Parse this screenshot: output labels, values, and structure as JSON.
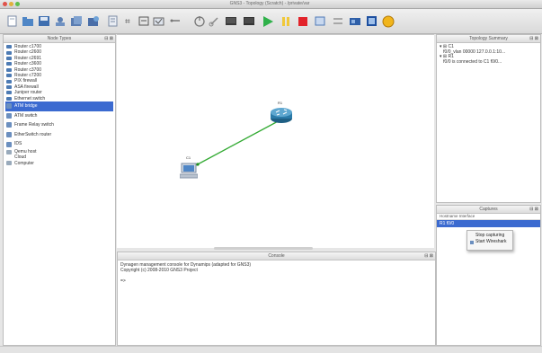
{
  "window": {
    "title": "GNS3 - Topology (Scratch) - /private/var"
  },
  "toolbar": {
    "icons": [
      "new-project-icon",
      "open-project-icon",
      "save-icon",
      "snapshot-icon",
      "import-icon",
      "export-icon",
      "topology-summary-icon",
      "add-note-icon",
      "add-rectangle-icon",
      "add-ellipse-icon",
      "clock-icon",
      "link-icon",
      "console-icon",
      "terminal-icon",
      "start-icon",
      "pause-icon",
      "stop-icon",
      "rectangle-icon",
      "ellipse-icon",
      "text-icon",
      "image-icon",
      "zoom-icon"
    ]
  },
  "node_types": {
    "title": "Node Types",
    "items": [
      {
        "label": "Router c1700",
        "icon": "router-icon"
      },
      {
        "label": "Router c2600",
        "icon": "router-icon"
      },
      {
        "label": "Router c2691",
        "icon": "router-icon"
      },
      {
        "label": "Router c3600",
        "icon": "router-icon"
      },
      {
        "label": "Router c3700",
        "icon": "router-icon"
      },
      {
        "label": "Router c7200",
        "icon": "router-icon"
      },
      {
        "label": "PIX firewall",
        "icon": "firewall-icon"
      },
      {
        "label": "ASA firewall",
        "icon": "firewall-icon"
      },
      {
        "label": "Juniper router",
        "icon": "router-icon"
      },
      {
        "label": "Ethernet switch",
        "icon": "switch-icon"
      },
      {
        "label": "ATM bridge",
        "icon": "atm-icon",
        "selected": true
      },
      {
        "label": "ATM switch",
        "icon": "atm-icon"
      },
      {
        "label": "Frame Relay switch",
        "icon": "frame-relay-icon"
      },
      {
        "label": "EtherSwitch router",
        "icon": "switch-icon"
      },
      {
        "label": "IDS",
        "icon": "ids-icon"
      },
      {
        "label": "Qemu host",
        "icon": "host-icon"
      },
      {
        "label": "Cloud",
        "icon": "cloud-icon"
      },
      {
        "label": "Computer",
        "icon": "computer-icon"
      }
    ]
  },
  "topology_summary": {
    "title": "Topology Summary",
    "lines": [
      "▾ ⊞ C1",
      "   f0/0_vlan 00000 127.0.0.1:10...",
      "▾ ⊞ R1",
      "   f0/0 is connected to C1 f0/0..."
    ]
  },
  "captures": {
    "title": "Captures",
    "headers": "Hostname  Interface",
    "row": "R1   f0/0"
  },
  "context_menu": {
    "items": [
      "Stop capturing",
      "Start Wireshark"
    ]
  },
  "console": {
    "title": "Console",
    "lines": [
      "Dynagen management console for Dynamips (adapted for GNS3)",
      "Copyright (c) 2008-2010 GNS3 Project",
      "",
      "=>"
    ]
  },
  "topology": {
    "router_label": "R1",
    "pc_label": "C1"
  }
}
